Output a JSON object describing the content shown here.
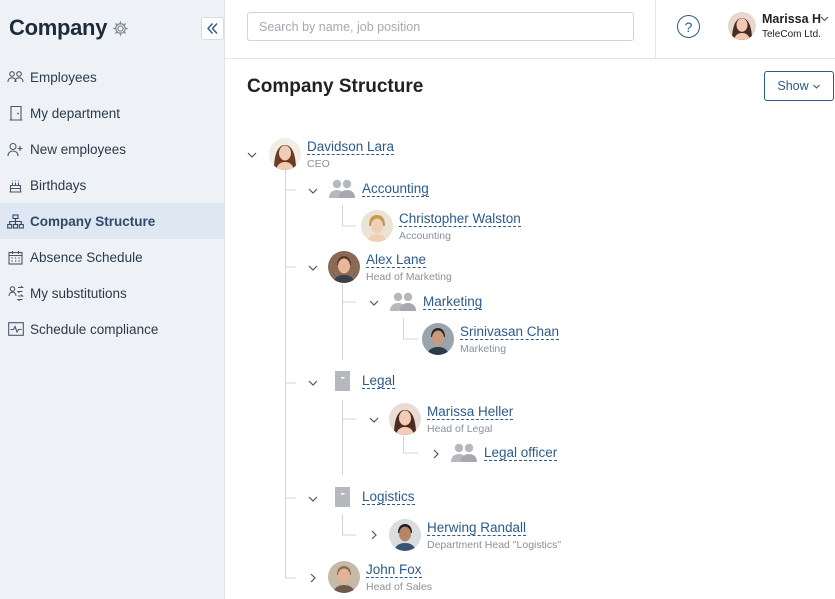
{
  "sidebar": {
    "title": "Company",
    "items": [
      {
        "label": "Employees",
        "icon": "employees-icon"
      },
      {
        "label": "My department",
        "icon": "door-icon"
      },
      {
        "label": "New employees",
        "icon": "add-user-icon"
      },
      {
        "label": "Birthdays",
        "icon": "cake-icon"
      },
      {
        "label": "Company Structure",
        "icon": "org-chart-icon",
        "active": true
      },
      {
        "label": "Absence Schedule",
        "icon": "calendar-icon"
      },
      {
        "label": "My substitutions",
        "icon": "substitution-icon"
      },
      {
        "label": "Schedule compliance",
        "icon": "pulse-icon"
      }
    ]
  },
  "header": {
    "search_placeholder": "Search by name, job position",
    "user_name": "Marissa H",
    "user_company": "TeleCom Ltd."
  },
  "main": {
    "title": "Company Structure",
    "show_label": "Show"
  },
  "tree": {
    "davidson": {
      "name": "Davidson Lara",
      "role": "CEO"
    },
    "accounting": {
      "name": "Accounting"
    },
    "walston": {
      "name": "Christopher Walston",
      "role": "Accounting"
    },
    "alex": {
      "name": "Alex Lane",
      "role": "Head of Marketing"
    },
    "marketing": {
      "name": "Marketing"
    },
    "srinivasan": {
      "name": "Srinivasan Chan",
      "role": "Marketing"
    },
    "legal": {
      "name": "Legal"
    },
    "marissa": {
      "name": "Marissa Heller",
      "role": "Head of Legal"
    },
    "legal_officer": {
      "name": "Legal officer"
    },
    "logistics": {
      "name": "Logistics"
    },
    "herwing": {
      "name": "Herwing Randall",
      "role": "Department Head \"Logistics\""
    },
    "john": {
      "name": "John Fox",
      "role": "Head of Sales"
    }
  },
  "colors": {
    "accent": "#2c5a8a",
    "sidebar_bg": "#eef2f7",
    "active_bg": "#dfe8f2"
  }
}
